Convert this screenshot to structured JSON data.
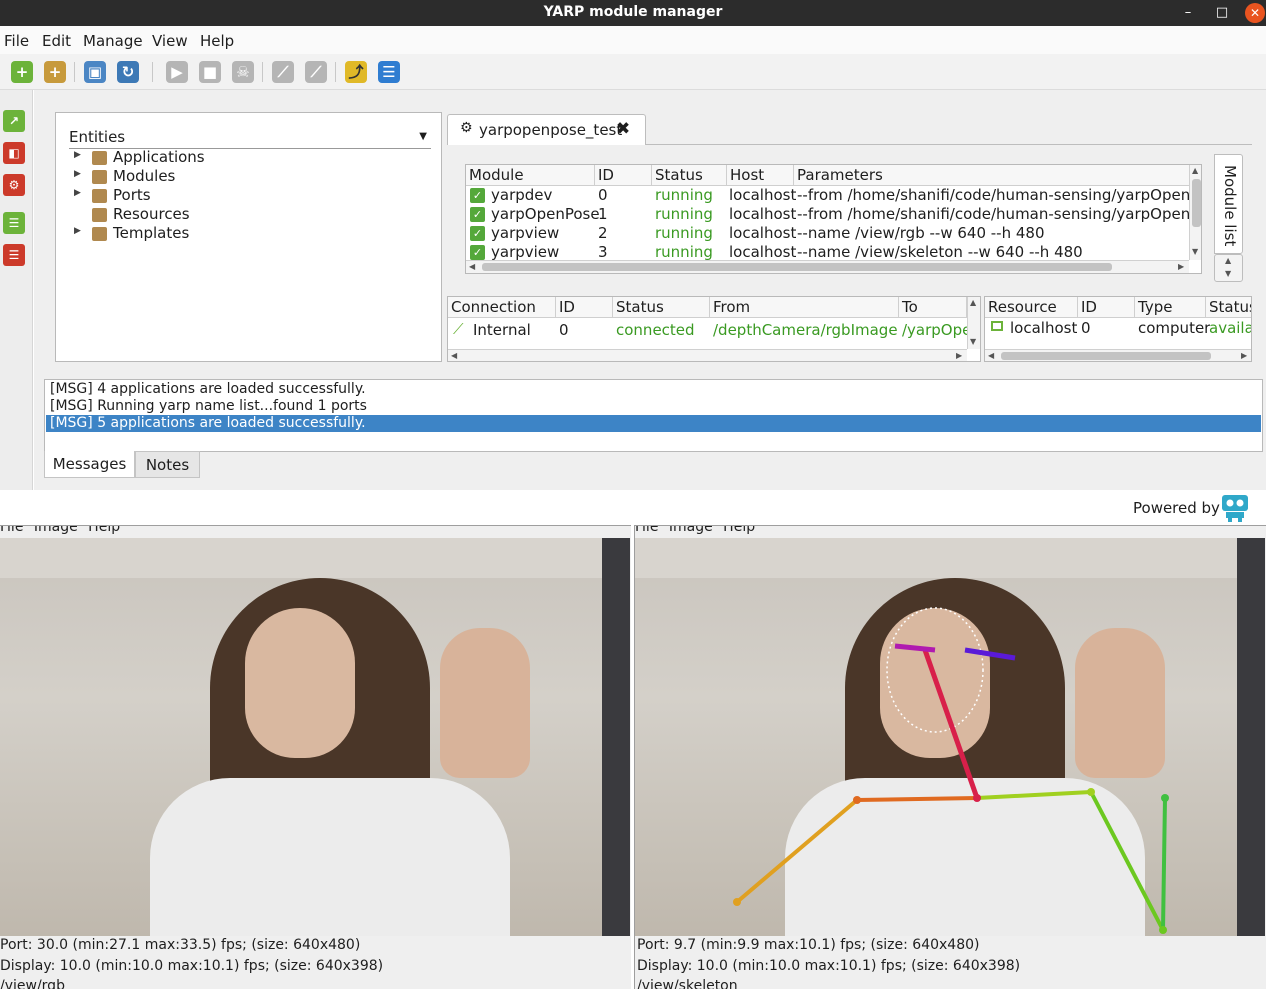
{
  "window": {
    "title": "YARP module manager",
    "min": "–",
    "max": "□",
    "close": "✕"
  },
  "menu": [
    "File",
    "Edit",
    "Manage",
    "View",
    "Help"
  ],
  "entities": {
    "header": "Entities",
    "items": [
      {
        "label": "Applications",
        "expandable": true
      },
      {
        "label": "Modules",
        "expandable": true
      },
      {
        "label": "Ports",
        "expandable": true
      },
      {
        "label": "Resources",
        "expandable": false
      },
      {
        "label": "Templates",
        "expandable": true
      }
    ]
  },
  "app_tab": {
    "label": "yarpopenpose_test",
    "gear": "⚙",
    "close": "✖"
  },
  "modules": {
    "columns": [
      "Module",
      "ID",
      "Status",
      "Host",
      "Parameters"
    ],
    "rows": [
      {
        "module": "yarpdev",
        "id": "0",
        "status": "running",
        "host": "localhost",
        "params": "--from /home/shanifi/code/human-sensing/yarpOpenPose"
      },
      {
        "module": "yarpOpenPose",
        "id": "1",
        "status": "running",
        "host": "localhost",
        "params": "--from /home/shanifi/code/human-sensing/yarpOpenPose"
      },
      {
        "module": "yarpview",
        "id": "2",
        "status": "running",
        "host": "localhost",
        "params": "--name /view/rgb --w 640 --h 480"
      },
      {
        "module": "yarpview",
        "id": "3",
        "status": "running",
        "host": "localhost",
        "params": "--name /view/skeleton --w 640 --h 480"
      }
    ]
  },
  "module_list_tab": "Module list",
  "connections": {
    "columns": [
      "Connection",
      "ID",
      "Status",
      "From",
      "To"
    ],
    "rows": [
      {
        "connection": "Internal",
        "id": "0",
        "status": "connected",
        "from": "/depthCamera/rgbImage:o",
        "to": "/yarpOpe"
      }
    ]
  },
  "resources": {
    "columns": [
      "Resource",
      "ID",
      "Type",
      "Status"
    ],
    "rows": [
      {
        "resource": "localhost",
        "id": "0",
        "type": "computer",
        "status": "availab"
      }
    ]
  },
  "log": {
    "lines": [
      "[MSG] 4 applications are loaded successfully.",
      "[MSG] Running yarp name list...found 1 ports",
      "[MSG] 5 applications are loaded successfully."
    ],
    "tabs": [
      "Messages",
      "Notes"
    ]
  },
  "powered_by": "Powered by",
  "viewers": [
    {
      "menu": "File  Image  Help",
      "port_stat": "Port: 30.0 (min:27.1 max:33.5) fps; (size: 640x480)",
      "display_stat": "Display: 10.0 (min:10.0 max:10.1) fps; (size: 640x398)",
      "name": "/view/rgb"
    },
    {
      "menu": "File  Image  Help",
      "port_stat": "Port: 9.7 (min:9.9 max:10.1) fps; (size: 640x480)",
      "display_stat": "Display: 10.0 (min:10.0 max:10.1) fps; (size: 640x398)",
      "name": "/view/skeleton"
    }
  ],
  "colors": {
    "accent": "#3d84c6",
    "running": "#3a9a22",
    "titlebar": "#2c2c2c",
    "close": "#e95420"
  }
}
